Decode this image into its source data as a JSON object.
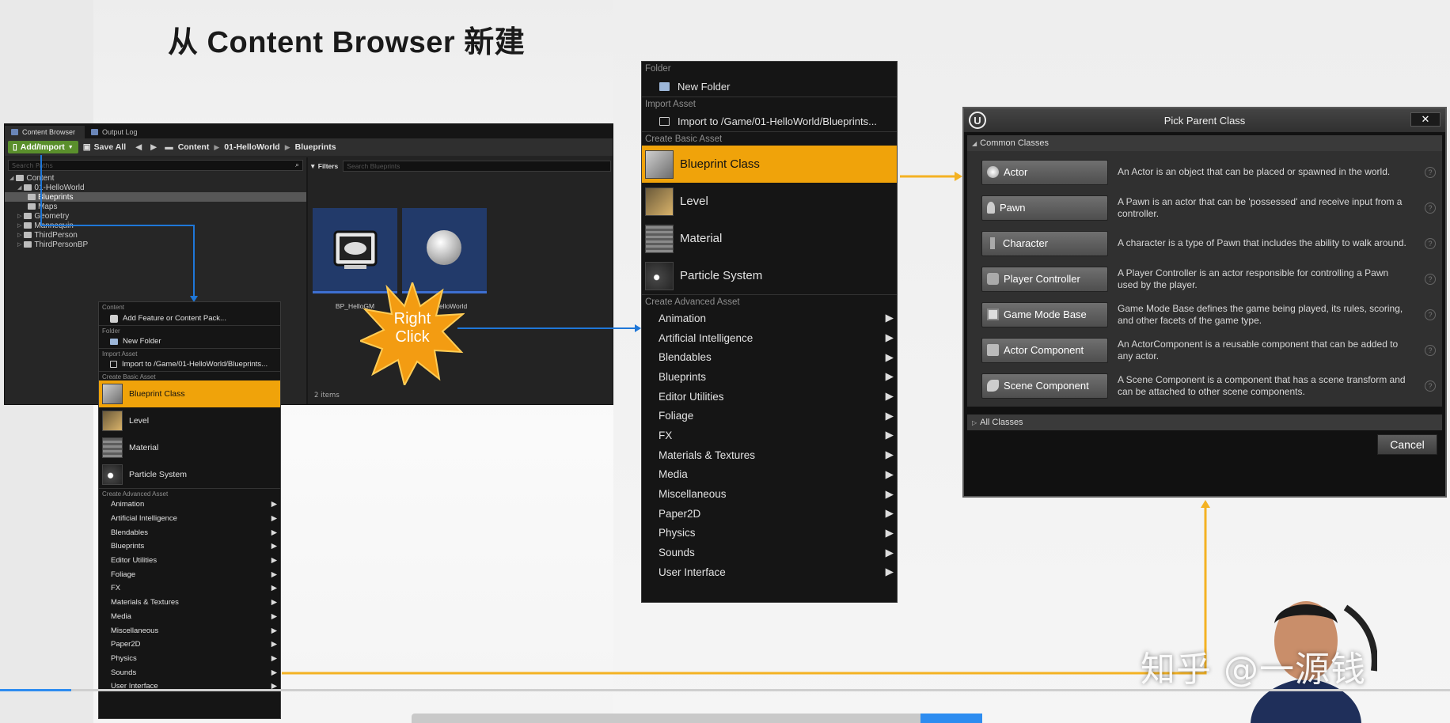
{
  "slide": {
    "title": "从 Content Browser 新建"
  },
  "content_browser": {
    "tabs": [
      "Content Browser",
      "Output Log"
    ],
    "toolbar": {
      "add_import": "Add/Import",
      "save_all": "Save All",
      "nav": "◀ ▶"
    },
    "breadcrumbs": [
      "Content",
      "01-HelloWorld",
      "Blueprints"
    ],
    "tree_search_placeholder": "Search Paths",
    "tree": [
      {
        "label": "Content",
        "indent": 0
      },
      {
        "label": "01-HelloWorld",
        "indent": 1
      },
      {
        "label": "Blueprints",
        "indent": 2,
        "selected": true
      },
      {
        "label": "Maps",
        "indent": 2
      },
      {
        "label": "Geometry",
        "indent": 1
      },
      {
        "label": "Mannequin",
        "indent": 1
      },
      {
        "label": "ThirdPerson",
        "indent": 1
      },
      {
        "label": "ThirdPersonBP",
        "indent": 1
      }
    ],
    "filters_label": "Filters",
    "asset_search_placeholder": "Search Blueprints",
    "assets": [
      {
        "name": "BP_HelloGM",
        "icon": "gamepad-icon"
      },
      {
        "name": "BP_HelloWorld",
        "icon": "sphere-icon"
      }
    ],
    "items_count": "2 items"
  },
  "burst": {
    "text_line1": "Right",
    "text_line2": "Click",
    "color": "#f39c12"
  },
  "small_menu": {
    "content_header": "Content",
    "add_feature": "Add Feature or Content Pack...",
    "folder_header": "Folder",
    "new_folder": "New Folder",
    "import_header": "Import Asset",
    "import_to": "Import to /Game/01-HelloWorld/Blueprints...",
    "basic_header": "Create Basic Asset",
    "basic": [
      {
        "label": "Blueprint Class",
        "icon": "blueprint-icon",
        "highlighted": true
      },
      {
        "label": "Level",
        "icon": "level-icon"
      },
      {
        "label": "Material",
        "icon": "material-icon"
      },
      {
        "label": "Particle System",
        "icon": "particle-icon"
      }
    ],
    "advanced_header": "Create Advanced Asset",
    "advanced": [
      "Animation",
      "Artificial Intelligence",
      "Blendables",
      "Blueprints",
      "Editor Utilities",
      "Foliage",
      "FX",
      "Materials & Textures",
      "Media",
      "Miscellaneous",
      "Paper2D",
      "Physics",
      "Sounds",
      "User Interface"
    ]
  },
  "big_menu": {
    "folder_header": "Folder",
    "new_folder": "New Folder",
    "import_header": "Import Asset",
    "import_to": "Import to /Game/01-HelloWorld/Blueprints...",
    "basic_header": "Create Basic Asset",
    "basic": [
      {
        "label": "Blueprint Class",
        "icon": "blueprint-icon",
        "highlighted": true
      },
      {
        "label": "Level",
        "icon": "level-icon"
      },
      {
        "label": "Material",
        "icon": "material-icon"
      },
      {
        "label": "Particle System",
        "icon": "particle-icon"
      }
    ],
    "advanced_header": "Create Advanced Asset",
    "advanced": [
      "Animation",
      "Artificial Intelligence",
      "Blendables",
      "Blueprints",
      "Editor Utilities",
      "Foliage",
      "FX",
      "Materials & Textures",
      "Media",
      "Miscellaneous",
      "Paper2D",
      "Physics",
      "Sounds",
      "User Interface"
    ]
  },
  "pick_parent_class": {
    "title": "Pick Parent Class",
    "close": "✕",
    "common_header": "Common Classes",
    "classes": [
      {
        "name": "Actor",
        "icon": "actor-icon",
        "desc": "An Actor is an object that can be placed or spawned in the world."
      },
      {
        "name": "Pawn",
        "icon": "pawn-icon",
        "desc": "A Pawn is an actor that can be 'possessed' and receive input from a controller."
      },
      {
        "name": "Character",
        "icon": "character-icon",
        "desc": "A character is a type of Pawn that includes the ability to walk around."
      },
      {
        "name": "Player Controller",
        "icon": "player-controller-icon",
        "desc": "A Player Controller is an actor responsible for controlling a Pawn used by the player."
      },
      {
        "name": "Game Mode Base",
        "icon": "game-mode-icon",
        "desc": "Game Mode Base defines the game being played, its rules, scoring, and other facets of the game type."
      },
      {
        "name": "Actor Component",
        "icon": "actor-component-icon",
        "desc": "An ActorComponent is a reusable component that can be added to any actor."
      },
      {
        "name": "Scene Component",
        "icon": "scene-component-icon",
        "desc": "A Scene Component is a component that has a scene transform and can be attached to other scene components."
      }
    ],
    "all_classes": "All Classes",
    "cancel": "Cancel"
  },
  "watermark": "知乎 @一源钱",
  "colors": {
    "highlight": "#f0a30a",
    "arrow_blue": "#1f77d8",
    "arrow_yellow": "#f4b223"
  }
}
